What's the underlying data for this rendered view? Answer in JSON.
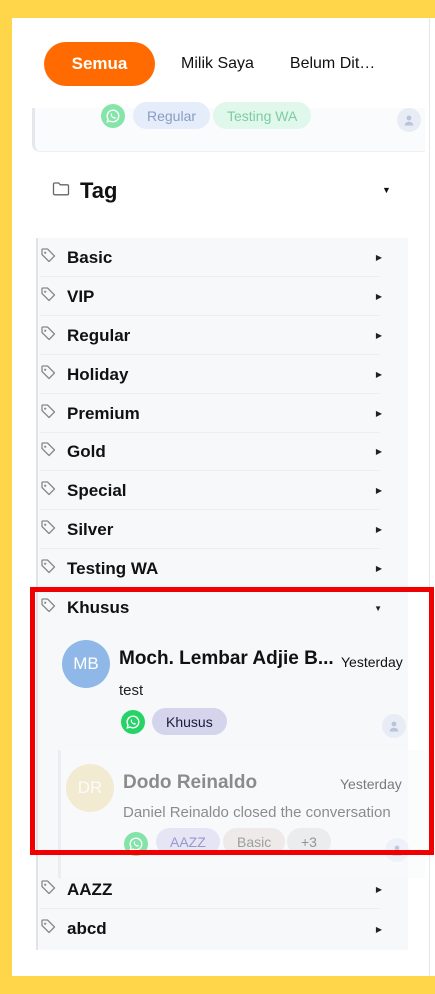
{
  "tabs": [
    {
      "label": "Semua",
      "active": true
    },
    {
      "label": "Milik Saya",
      "active": false
    },
    {
      "label": "Belum Ditugaskan",
      "active": false
    }
  ],
  "top_card": {
    "tags": [
      "Regular",
      "Testing WA"
    ]
  },
  "tag_section": {
    "title": "Tag",
    "items": [
      {
        "label": "Basic"
      },
      {
        "label": "VIP"
      },
      {
        "label": "Regular"
      },
      {
        "label": "Holiday"
      },
      {
        "label": "Premium"
      },
      {
        "label": "Gold"
      },
      {
        "label": "Special"
      },
      {
        "label": "Silver"
      },
      {
        "label": "Testing WA"
      },
      {
        "label": "Khusus",
        "expanded": true
      },
      {
        "label": "AAZZ"
      },
      {
        "label": "abcd"
      }
    ]
  },
  "conversations": [
    {
      "initials": "MB",
      "name": "Moch. Lembar Adjie B...",
      "time": "Yesterday",
      "message": "test",
      "tags": [
        "Khusus"
      ],
      "avatar_color": "#8FB8E8"
    },
    {
      "initials": "DR",
      "name": "Dodo Reinaldo",
      "time": "Yesterday",
      "message": "Daniel Reinaldo closed the conversation",
      "tags": [
        "AAZZ",
        "Basic",
        "+3"
      ],
      "avatar_color": "#EEDFB0"
    }
  ],
  "colors": {
    "accent": "#FF6B00",
    "whatsapp": "#25D366",
    "selection": "#F00000"
  }
}
